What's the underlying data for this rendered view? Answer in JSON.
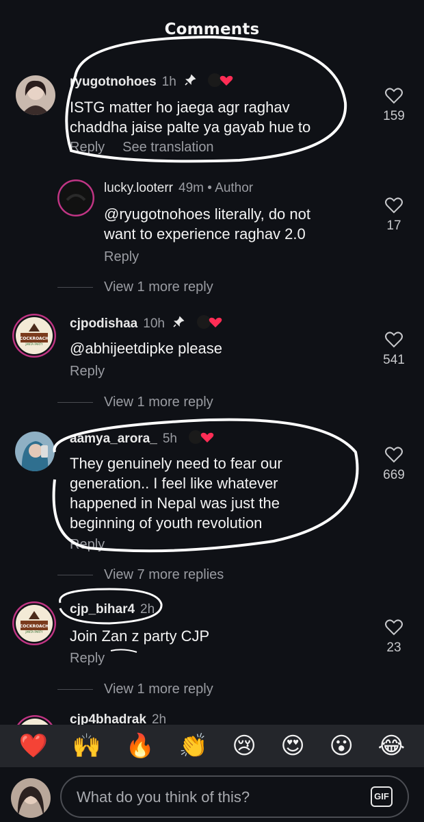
{
  "header": {
    "title": "Comments"
  },
  "comments": [
    {
      "username": "ryugotnohoes",
      "time": "1h",
      "pinned": true,
      "text_lines": [
        "ISTG matter ho jaega agr raghav",
        "chaddha jaise palte ya gayab hue to"
      ],
      "reply_label": "Reply",
      "translate_label": "See translation",
      "likes": "159"
    },
    {
      "username": "lucky.looterr",
      "time": "49m",
      "author_tag": "• Author",
      "text_lines": [
        "@ryugotnohoes literally, do not",
        "want to experience raghav 2.0"
      ],
      "reply_label": "Reply",
      "likes": "17",
      "view_more": "View 1 more reply"
    },
    {
      "username": "cjpodishaa",
      "time": "10h",
      "pinned": true,
      "text_lines": [
        "@abhijeetdipke please"
      ],
      "reply_label": "Reply",
      "likes": "541",
      "view_more": "View 1 more reply"
    },
    {
      "username": "aamya_arora_",
      "time": "5h",
      "text_lines": [
        "They genuinely need to fear our",
        "generation.. I feel like whatever",
        "happened in Nepal was just the",
        "beginning of youth revolution"
      ],
      "reply_label": "Reply",
      "likes": "669",
      "view_more": "View 7 more replies"
    },
    {
      "username": "cjp_bihar4",
      "time": "2h",
      "text_lines": [
        "Join Zan z party CJP"
      ],
      "reply_label": "Reply",
      "likes": "23",
      "view_more": "View 1 more reply"
    },
    {
      "username": "cjp4bhadrak",
      "time": "2h"
    }
  ],
  "avatars": {
    "party_badge_text": [
      "COCKROACH",
      "JANTA PARTY"
    ]
  },
  "emoji_bar": [
    "❤️",
    "🙌",
    "🔥",
    "👏",
    "😢",
    "😍",
    "😮",
    "😂"
  ],
  "composer": {
    "placeholder": "What do you think of this?",
    "gif_label": "GIF"
  },
  "colors": {
    "background": "#0f1116",
    "muted": "#9a9ca2",
    "heart_red": "#ff2d55",
    "annotation": "#ffffff"
  }
}
